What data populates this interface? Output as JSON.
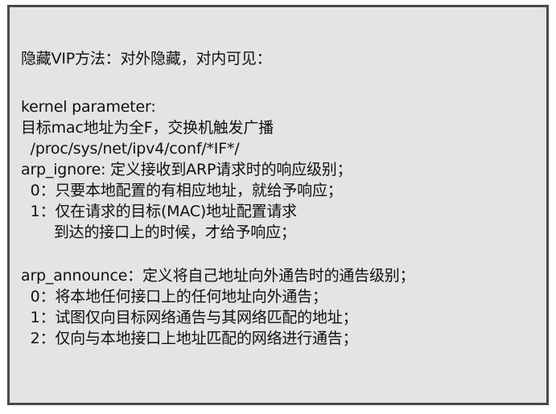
{
  "note": {
    "lines": [
      "隐藏VIP方法：对外隐藏，对内可见：",
      "kernel parameter:",
      "目标mac地址为全F，交换机触发广播",
      "  /proc/sys/net/ipv4/conf/*IF*/",
      "arp_ignore: 定义接收到ARP请求时的响应级别；",
      "  0：只要本地配置的有相应地址，就给予响应；",
      "  1：仅在请求的目标(MAC)地址配置请求",
      "       到达的接口上的时候，才给予响应；",
      "arp_announce：定义将自己地址向外通告时的通告级别；",
      "  0：将本地任何接口上的任何地址向外通告；",
      "  1：试图仅向目标网络通告与其网络匹配的地址；",
      "  2：仅向与本地接口上地址匹配的网络进行通告；"
    ]
  }
}
